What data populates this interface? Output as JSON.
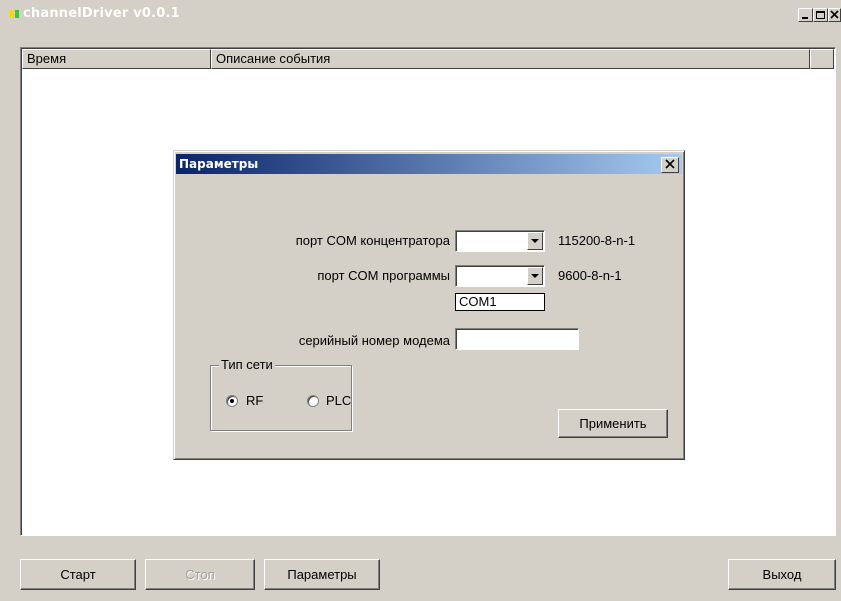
{
  "window": {
    "title": "channelDriver v0.0.1",
    "caption_buttons": [
      "minimize-icon",
      "maximize-icon",
      "close-icon"
    ],
    "logo_colors": [
      "#ffd700",
      "#32cd32"
    ]
  },
  "events_list": {
    "columns": [
      "Время",
      "Описание события"
    ],
    "rows": []
  },
  "dialog": {
    "title": "Параметры",
    "close_icon": "close-icon",
    "hub_port": {
      "label": "порт COM концентратора",
      "value": "",
      "info": "115200-8-n-1"
    },
    "app_port": {
      "label": "порт COM программы",
      "value": "",
      "info": "9600-8-n-1",
      "open_option": "COM1"
    },
    "modem_serial": {
      "label": "серийный номер модема",
      "value": ""
    },
    "network_type": {
      "caption": "Тип сети",
      "options": [
        {
          "label": "RF",
          "selected": true
        },
        {
          "label": "PLC",
          "selected": false
        }
      ]
    },
    "apply_label": "Применить"
  },
  "toolbar": {
    "start_label": "Старт",
    "stop_label": "Стоп",
    "params_label": "Параметры",
    "exit_label": "Выход"
  }
}
